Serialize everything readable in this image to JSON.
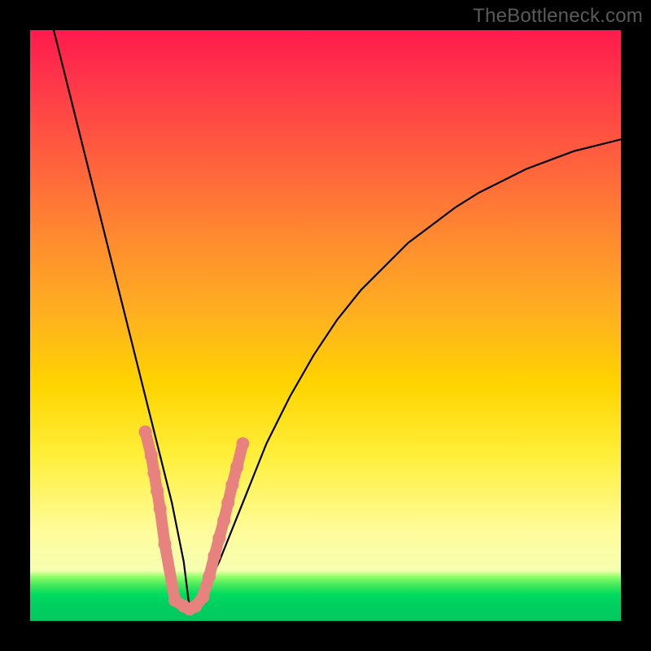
{
  "domain": "Chart",
  "watermark": "TheBottleneck.com",
  "colors": {
    "frame": "#000000",
    "curve": "#000000",
    "dots": "#e8827e",
    "gradient_stops": [
      "#ff1a4c",
      "#ff5a3f",
      "#ffd400",
      "#fffc9c",
      "#00d060"
    ]
  },
  "chart_data": {
    "type": "line",
    "title": "",
    "xlabel": "",
    "ylabel": "",
    "xlim": [
      0,
      100
    ],
    "ylim": [
      0,
      100
    ],
    "note": "Axes are unlabeled; values are read as percent of plot width/height from bottom-left. Curve plunges from top-left to a minimum near x≈27 at y≈2, then rises smoothly toward top-right. Pink dots mark points near the trough and lower flanks.",
    "series": [
      {
        "name": "curve",
        "x": [
          4,
          6,
          8,
          10,
          12,
          14,
          16,
          18,
          20,
          22,
          24,
          26,
          27,
          28,
          30,
          32,
          34,
          36,
          38,
          40,
          44,
          48,
          52,
          56,
          60,
          64,
          68,
          72,
          76,
          80,
          84,
          88,
          92,
          96,
          100
        ],
        "y": [
          100,
          92,
          84,
          76,
          68,
          60,
          52,
          44,
          36,
          28,
          20,
          10,
          2,
          3,
          6,
          10,
          15,
          20,
          25,
          30,
          38,
          45,
          51,
          56,
          60,
          64,
          67,
          70,
          72.5,
          74.5,
          76.5,
          78,
          79.5,
          80.5,
          81.5
        ]
      },
      {
        "name": "dots",
        "x": [
          19.5,
          20.5,
          21.0,
          21.5,
          22.0,
          22.8,
          24.5,
          26.0,
          27.0,
          28.0,
          29.2,
          30.3,
          31.2,
          32.0,
          32.8,
          33.5,
          34.2,
          35.0,
          36.0
        ],
        "y": [
          32.0,
          28.0,
          25.0,
          22.0,
          19.0,
          13.0,
          3.5,
          2.5,
          2.0,
          2.5,
          4.0,
          7.5,
          11.0,
          14.0,
          17.0,
          20.0,
          23.0,
          26.0,
          30.0
        ]
      }
    ]
  }
}
